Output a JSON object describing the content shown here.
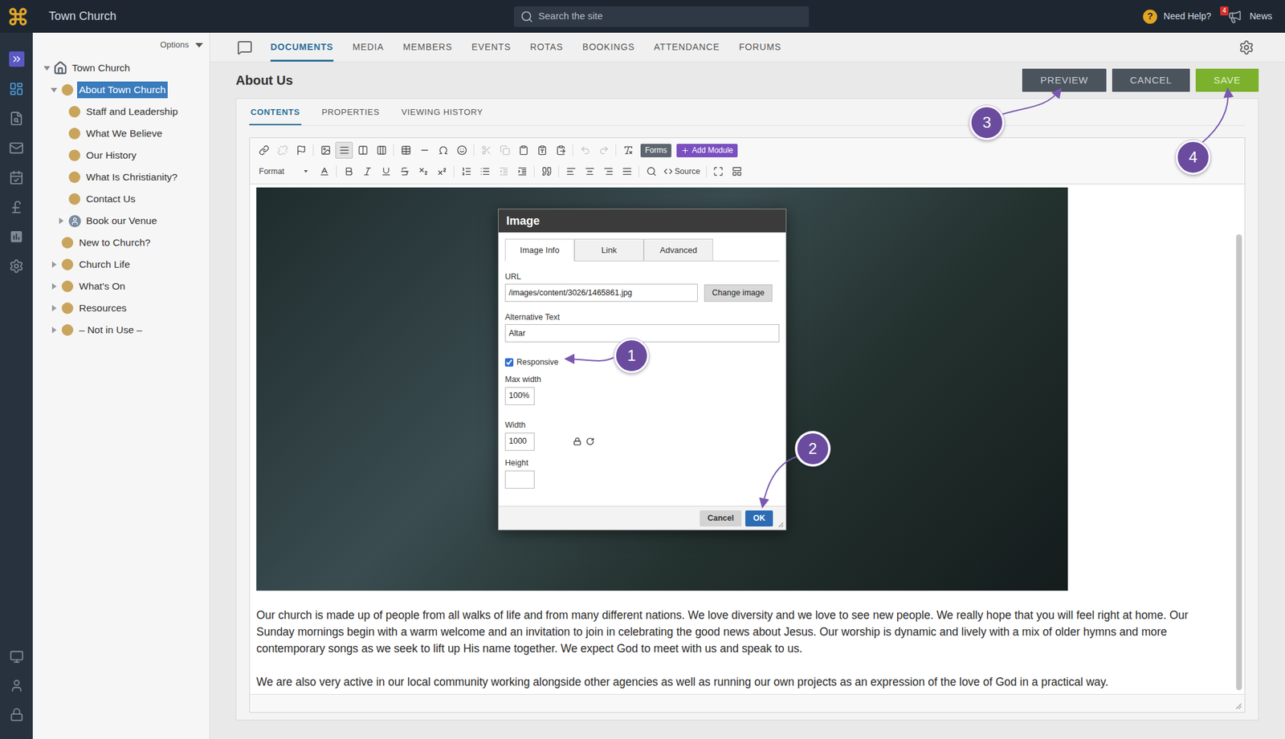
{
  "topbar": {
    "title": "Town Church",
    "search_placeholder": "Search the site",
    "help_icon": "?",
    "help_label": "Need Help?",
    "news_badge": "4",
    "news_label": "News"
  },
  "rail": {
    "items": [
      {
        "selected": true
      },
      {
        "selected": false
      },
      {
        "selected": false
      },
      {
        "selected": false
      },
      {
        "selected": false
      },
      {
        "selected": false
      },
      {
        "selected": false
      }
    ],
    "bottom": [
      {
        "selected": false
      },
      {
        "selected": false
      },
      {
        "selected": false
      }
    ]
  },
  "sidebar": {
    "options_label": "Options",
    "items": [
      {
        "label": "Town Church",
        "depth": 0,
        "kind": "home",
        "expandable": true,
        "expanded": true,
        "selected": false
      },
      {
        "label": "About Town Church",
        "depth": 1,
        "kind": "page",
        "expandable": true,
        "expanded": true,
        "selected": true
      },
      {
        "label": "Staff and Leadership",
        "depth": 2,
        "kind": "page",
        "expandable": false,
        "expanded": false,
        "selected": false
      },
      {
        "label": "What We Believe",
        "depth": 2,
        "kind": "page",
        "expandable": false,
        "expanded": false,
        "selected": false
      },
      {
        "label": "Our History",
        "depth": 2,
        "kind": "page",
        "expandable": false,
        "expanded": false,
        "selected": false
      },
      {
        "label": "What Is Christianity?",
        "depth": 2,
        "kind": "page",
        "expandable": false,
        "expanded": false,
        "selected": false
      },
      {
        "label": "Contact Us",
        "depth": 2,
        "kind": "page",
        "expandable": false,
        "expanded": false,
        "selected": false
      },
      {
        "label": "Book our Venue",
        "depth": 2,
        "kind": "person",
        "expandable": true,
        "expanded": false,
        "selected": false
      },
      {
        "label": "New to Church?",
        "depth": 1,
        "kind": "page",
        "expandable": false,
        "expanded": false,
        "selected": false
      },
      {
        "label": "Church Life",
        "depth": 1,
        "kind": "page",
        "expandable": true,
        "expanded": false,
        "selected": false
      },
      {
        "label": "What's On",
        "depth": 1,
        "kind": "page",
        "expandable": true,
        "expanded": false,
        "selected": false
      },
      {
        "label": "Resources",
        "depth": 1,
        "kind": "page",
        "expandable": true,
        "expanded": false,
        "selected": false
      },
      {
        "label": "– Not in Use –",
        "depth": 1,
        "kind": "page",
        "expandable": true,
        "expanded": false,
        "selected": false
      }
    ]
  },
  "nav": {
    "tabs": [
      {
        "label": "DOCUMENTS",
        "selected": true
      },
      {
        "label": "MEDIA",
        "selected": false
      },
      {
        "label": "MEMBERS",
        "selected": false
      },
      {
        "label": "EVENTS",
        "selected": false
      },
      {
        "label": "ROTAS",
        "selected": false
      },
      {
        "label": "BOOKINGS",
        "selected": false
      },
      {
        "label": "ATTENDANCE",
        "selected": false
      },
      {
        "label": "FORUMS",
        "selected": false
      }
    ]
  },
  "page": {
    "title": "About Us",
    "buttons": [
      {
        "label": "PREVIEW",
        "kind": "secondary"
      },
      {
        "label": "CANCEL",
        "kind": "secondary"
      },
      {
        "label": "SAVE",
        "kind": "primary"
      }
    ]
  },
  "subtabs": [
    {
      "label": "CONTENTS",
      "selected": true
    },
    {
      "label": "PROPERTIES",
      "selected": false
    },
    {
      "label": "VIEWING HISTORY",
      "selected": false
    }
  ],
  "editor": {
    "toolbar": {
      "row1": [
        {
          "disabled": false,
          "selected": false
        },
        {
          "disabled": true,
          "selected": false
        },
        {
          "disabled": false,
          "selected": false
        },
        {
          "disabled": false,
          "selected": false
        },
        {
          "disabled": false,
          "selected": true
        },
        {
          "disabled": false,
          "selected": false
        },
        {
          "disabled": false,
          "selected": false
        },
        {
          "disabled": false,
          "selected": false
        },
        {
          "disabled": false,
          "selected": false
        },
        {
          "disabled": false,
          "selected": false
        },
        {
          "disabled": false,
          "selected": false
        },
        {
          "disabled": true,
          "selected": false
        },
        {
          "disabled": true,
          "selected": false
        },
        {
          "disabled": false,
          "selected": false
        },
        {
          "disabled": false,
          "selected": false
        },
        {
          "disabled": false,
          "selected": false
        },
        {
          "disabled": true,
          "selected": false
        },
        {
          "disabled": true,
          "selected": false
        },
        {
          "disabled": false,
          "selected": false
        }
      ],
      "forms": "Forms",
      "add_module": "Add Module",
      "format": "Format",
      "row2": [
        {
          "disabled": false
        },
        {
          "disabled": false
        },
        {
          "disabled": false
        },
        {
          "disabled": false
        },
        {
          "disabled": false
        },
        {
          "disabled": false
        },
        {
          "disabled": false
        },
        {
          "disabled": false
        },
        {
          "disabled": false
        },
        {
          "disabled": true
        },
        {
          "disabled": false
        },
        {
          "disabled": false
        },
        {
          "disabled": false
        },
        {
          "disabled": false
        },
        {
          "disabled": false
        },
        {
          "disabled": false
        },
        {
          "disabled": false
        },
        {
          "disabled": false
        },
        {
          "disabled": false
        }
      ],
      "source": "Source"
    },
    "paragraphs": [
      "Our church is made up of people from all walks of life and from many different nations. We love diversity and we love to see new people. We really hope that you will feel right at home. Our Sunday mornings begin with a warm welcome and an invitation to join in celebrating the good news about Jesus. Our worship is dynamic and lively with a mix of older hymns and more contemporary songs as we seek to lift up His name together. We expect God to meet with us and speak to us.",
      "We are also very active in our local community working alongside other agencies as well as running our own projects as an expression of the love of God in a practical way."
    ]
  },
  "dialog": {
    "title": "Image",
    "tabs": [
      {
        "label": "Image Info",
        "selected": true
      },
      {
        "label": "Link",
        "selected": false
      },
      {
        "label": "Advanced",
        "selected": false
      }
    ],
    "url_label": "URL",
    "url": "/images/content/3026/1465861.jpg",
    "change_image": "Change image",
    "alt_label": "Alternative Text",
    "alt": "Altar",
    "responsive": {
      "label": "Responsive",
      "checked": true
    },
    "max_width": {
      "label": "Max width",
      "value": "100%"
    },
    "width": {
      "label": "Width",
      "value": "1000"
    },
    "height": {
      "label": "Height",
      "value": ""
    },
    "buttons": [
      {
        "label": "Cancel",
        "kind": "secondary"
      },
      {
        "label": "OK",
        "kind": "primary"
      }
    ]
  },
  "callouts": [
    "1",
    "2",
    "3",
    "4"
  ]
}
